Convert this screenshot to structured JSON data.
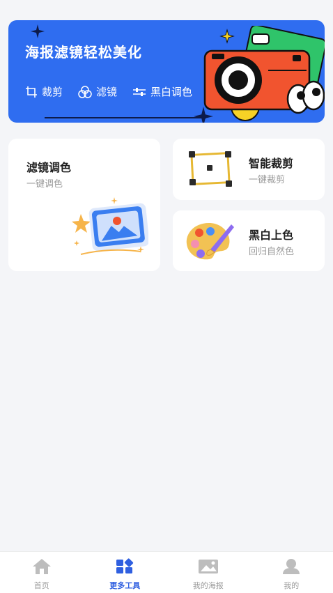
{
  "banner": {
    "title": "海报滤镜轻松美化",
    "tools": [
      {
        "label": "裁剪",
        "icon": "crop-icon"
      },
      {
        "label": "滤镜",
        "icon": "filter-icon"
      },
      {
        "label": "黑白调色",
        "icon": "sliders-icon"
      }
    ]
  },
  "cards": {
    "filter": {
      "title": "滤镜调色",
      "subtitle": "一键调色",
      "icon": "picture-frame-icon"
    },
    "crop": {
      "title": "智能裁剪",
      "subtitle": "一键裁剪",
      "icon": "crop-frame-icon"
    },
    "colorize": {
      "title": "黑白上色",
      "subtitle": "回归自然色",
      "icon": "palette-icon"
    }
  },
  "tabbar": {
    "items": [
      {
        "label": "首页",
        "icon": "home-icon"
      },
      {
        "label": "更多工具",
        "icon": "grid-tools-icon",
        "active": true
      },
      {
        "label": "我的海报",
        "icon": "image-icon"
      },
      {
        "label": "我的",
        "icon": "user-icon"
      }
    ]
  },
  "colors": {
    "accent": "#2f6df0",
    "tab_active": "#2f5fe0",
    "background": "#f4f5f8"
  }
}
